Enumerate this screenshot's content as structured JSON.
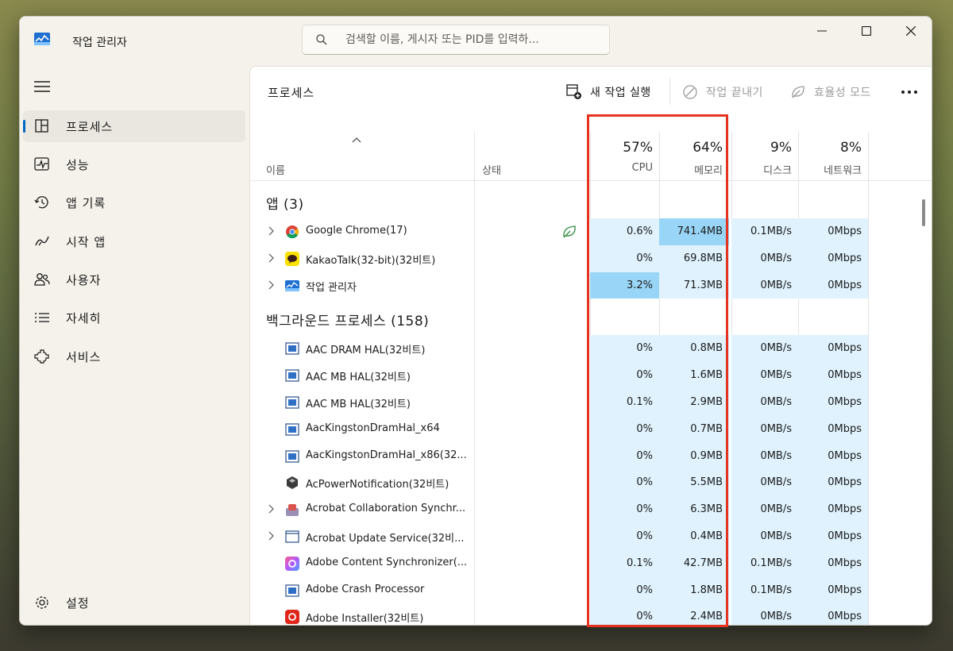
{
  "app": {
    "title": "작업 관리자",
    "search_placeholder": "검색할 이름, 게시자 또는 PID를 입력하..."
  },
  "sidebar": {
    "items": [
      {
        "label": "프로세스",
        "icon": "processes-icon",
        "active": true
      },
      {
        "label": "성능",
        "icon": "performance-icon"
      },
      {
        "label": "앱 기록",
        "icon": "app-history-icon"
      },
      {
        "label": "시작 앱",
        "icon": "startup-apps-icon"
      },
      {
        "label": "사용자",
        "icon": "users-icon"
      },
      {
        "label": "자세히",
        "icon": "details-icon"
      },
      {
        "label": "서비스",
        "icon": "services-icon"
      }
    ],
    "settings_label": "설정"
  },
  "main": {
    "page_title": "프로세스",
    "toolbar": {
      "run_new_task": "새 작업 실행",
      "end_task": "작업 끝내기",
      "efficiency_mode": "효율성 모드"
    },
    "columns": {
      "name": "이름",
      "status": "상태",
      "cpu": {
        "pct": "57%",
        "label": "CPU"
      },
      "memory": {
        "pct": "64%",
        "label": "메모리"
      },
      "disk": {
        "pct": "9%",
        "label": "디스크"
      },
      "network": {
        "pct": "8%",
        "label": "네트워크"
      }
    },
    "apps_group": "앱 (3)",
    "background_group": "백그라운드 프로세스 (158)",
    "apps": [
      {
        "name": "Google Chrome(17)",
        "icon": "chrome-icon",
        "expandable": true,
        "efficiency": true,
        "cpu": "0.6%",
        "memory": "741.4MB",
        "disk": "0.1MB/s",
        "network": "0Mbps"
      },
      {
        "name": "KakaoTalk(32-bit)(32비트)",
        "icon": "kakaotalk-icon",
        "expandable": true,
        "cpu": "0%",
        "memory": "69.8MB",
        "disk": "0MB/s",
        "network": "0Mbps"
      },
      {
        "name": "작업 관리자",
        "icon": "task-manager-icon",
        "expandable": true,
        "cpu": "3.2%",
        "memory": "71.3MB",
        "disk": "0MB/s",
        "network": "0Mbps"
      }
    ],
    "background": [
      {
        "name": "AAC DRAM HAL(32비트)",
        "icon": "window-app-icon",
        "cpu": "0%",
        "memory": "0.8MB",
        "disk": "0MB/s",
        "network": "0Mbps"
      },
      {
        "name": "AAC MB HAL(32비트)",
        "icon": "window-app-icon",
        "cpu": "0%",
        "memory": "1.6MB",
        "disk": "0MB/s",
        "network": "0Mbps"
      },
      {
        "name": "AAC MB HAL(32비트)",
        "icon": "window-app-icon",
        "cpu": "0.1%",
        "memory": "2.9MB",
        "disk": "0MB/s",
        "network": "0Mbps"
      },
      {
        "name": "AacKingstonDramHal_x64",
        "icon": "window-app-icon",
        "cpu": "0%",
        "memory": "0.7MB",
        "disk": "0MB/s",
        "network": "0Mbps"
      },
      {
        "name": "AacKingstonDramHal_x86(32...",
        "icon": "window-app-icon",
        "cpu": "0%",
        "memory": "0.9MB",
        "disk": "0MB/s",
        "network": "0Mbps"
      },
      {
        "name": "AcPowerNotification(32비트)",
        "icon": "power-notification-icon",
        "cpu": "0%",
        "memory": "5.5MB",
        "disk": "0MB/s",
        "network": "0Mbps"
      },
      {
        "name": "Acrobat Collaboration Synchr...",
        "icon": "acrobat-collab-icon",
        "expandable": true,
        "cpu": "0%",
        "memory": "6.3MB",
        "disk": "0MB/s",
        "network": "0Mbps"
      },
      {
        "name": "Acrobat Update Service(32비...",
        "icon": "window-blank-icon",
        "expandable": true,
        "cpu": "0%",
        "memory": "0.4MB",
        "disk": "0MB/s",
        "network": "0Mbps"
      },
      {
        "name": "Adobe Content Synchronizer(...",
        "icon": "adobe-cc-icon",
        "cpu": "0.1%",
        "memory": "42.7MB",
        "disk": "0.1MB/s",
        "network": "0Mbps"
      },
      {
        "name": "Adobe Crash Processor",
        "icon": "window-app-icon",
        "cpu": "0%",
        "memory": "1.8MB",
        "disk": "0.1MB/s",
        "network": "0Mbps"
      },
      {
        "name": "Adobe Installer(32비트)",
        "icon": "adobe-installer-icon",
        "cpu": "0%",
        "memory": "2.4MB",
        "disk": "0MB/s",
        "network": "0Mbps"
      }
    ]
  },
  "colors": {
    "heat_low": "#dff2fd",
    "heat_mid": "#bde6fb",
    "heat_high": "#99d5f6",
    "highlight_border": "#e53320",
    "accent": "#0067c0"
  }
}
